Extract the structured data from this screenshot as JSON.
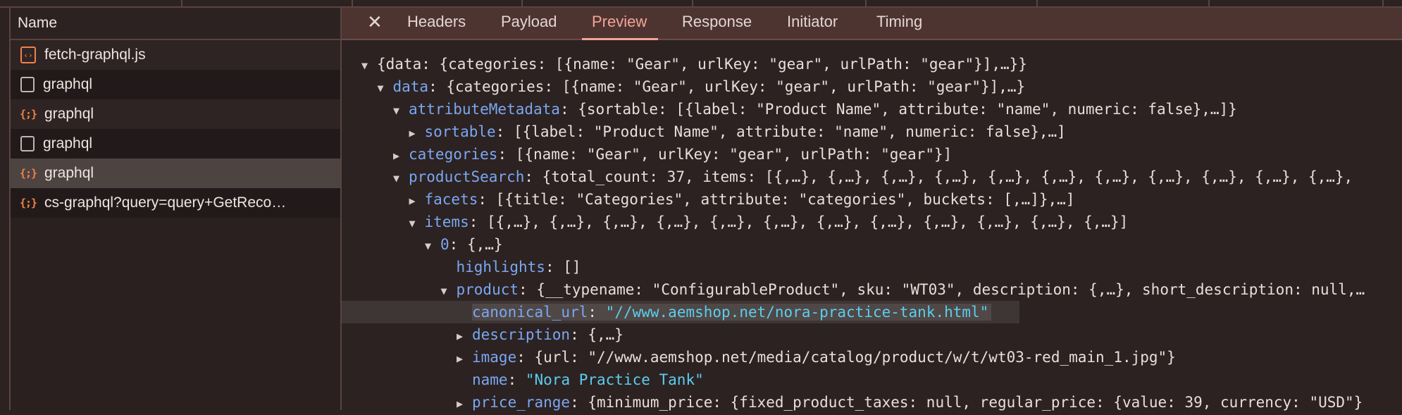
{
  "network_list": {
    "header": "Name",
    "rows": [
      {
        "name": "fetch-graphql.js",
        "icon": "script-icon"
      },
      {
        "name": "graphql",
        "icon": "document-icon"
      },
      {
        "name": "graphql",
        "icon": "json-icon"
      },
      {
        "name": "graphql",
        "icon": "document-icon"
      },
      {
        "name": "graphql",
        "icon": "json-icon",
        "selected": true
      },
      {
        "name": "cs-graphql?query=query+GetReco…",
        "icon": "json-icon"
      }
    ]
  },
  "detail_tabs": {
    "close_label": "✕",
    "tabs": [
      "Headers",
      "Payload",
      "Preview",
      "Response",
      "Initiator",
      "Timing"
    ],
    "active": "Preview"
  },
  "colors": {
    "accent": "#f2a497",
    "key": "#7ba7f2",
    "string": "#5ccdf0",
    "header_bg": "#4e3431"
  },
  "preview": {
    "lines": [
      {
        "level": 0,
        "toggle": "expanded",
        "key": "",
        "value": "{data: {categories: [{name: \"Gear\", urlKey: \"gear\", urlPath: \"gear\"}],…}}"
      },
      {
        "level": 1,
        "toggle": "expanded",
        "key": "data",
        "value": "{categories: [{name: \"Gear\", urlKey: \"gear\", urlPath: \"gear\"}],…}"
      },
      {
        "level": 2,
        "toggle": "expanded",
        "key": "attributeMetadata",
        "value": "{sortable: [{label: \"Product Name\", attribute: \"name\", numeric: false},…]}"
      },
      {
        "level": 3,
        "toggle": "collapsed",
        "key": "sortable",
        "value": "[{label: \"Product Name\", attribute: \"name\", numeric: false},…]"
      },
      {
        "level": 2,
        "toggle": "collapsed",
        "key": "categories",
        "value": "[{name: \"Gear\", urlKey: \"gear\", urlPath: \"gear\"}]"
      },
      {
        "level": 2,
        "toggle": "expanded",
        "key": "productSearch",
        "value": "{total_count: 37, items: [{,…}, {,…}, {,…}, {,…}, {,…}, {,…}, {,…}, {,…}, {,…}, {,…}, {,…},"
      },
      {
        "level": 3,
        "toggle": "collapsed",
        "key": "facets",
        "value": "[{title: \"Categories\", attribute: \"categories\", buckets: [,…]},…]"
      },
      {
        "level": 3,
        "toggle": "expanded",
        "key": "items",
        "value": "[{,…}, {,…}, {,…}, {,…}, {,…}, {,…}, {,…}, {,…}, {,…}, {,…}, {,…}, {,…}]"
      },
      {
        "level": 4,
        "toggle": "expanded",
        "key": "0",
        "value": "{,…}"
      },
      {
        "level": 5,
        "toggle": "none",
        "key": "highlights",
        "value": "[]"
      },
      {
        "level": 5,
        "toggle": "expanded",
        "key": "product",
        "value": "{__typename: \"ConfigurableProduct\", sku: \"WT03\", description: {,…}, short_description: null,…"
      },
      {
        "level": 6,
        "toggle": "none",
        "key": "canonical_url",
        "value": "\"//www.aemshop.net/nora-practice-tank.html\"",
        "string": true,
        "highlighted": true
      },
      {
        "level": 6,
        "toggle": "collapsed",
        "key": "description",
        "value": "{,…}"
      },
      {
        "level": 6,
        "toggle": "collapsed",
        "key": "image",
        "value": "{url: \"//www.aemshop.net/media/catalog/product/w/t/wt03-red_main_1.jpg\"}"
      },
      {
        "level": 6,
        "toggle": "none",
        "key": "name",
        "value": "\"Nora Practice Tank\"",
        "string": true
      },
      {
        "level": 6,
        "toggle": "collapsed",
        "key": "price_range",
        "value": "{minimum_price: {fixed_product_taxes: null, regular_price: {value: 39, currency: \"USD\"}"
      }
    ]
  }
}
